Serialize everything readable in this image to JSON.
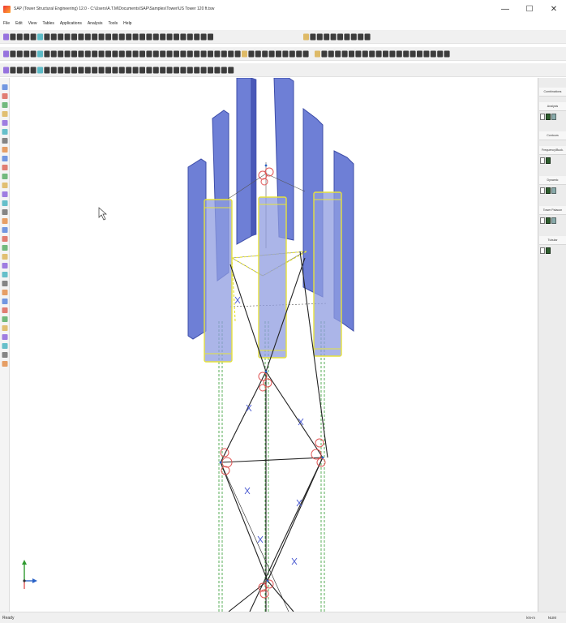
{
  "window": {
    "title": "SAP (Tower Structural Engineering) 12.0 - C:\\Users\\A.T.M\\Documents\\SAP\\Samples\\Tower\\US Tower 120 ft.tsw",
    "minimize": "—",
    "maximize": "☐",
    "close": "✕"
  },
  "menu": [
    "File",
    "Edit",
    "View",
    "Tables",
    "Applications",
    "Analysis",
    "Tools",
    "Help"
  ],
  "right_panel": {
    "combinations": "Combinations",
    "groups": [
      "Analysis",
      "Contours",
      "Frequency/Buck.",
      "Dynamic",
      "Tower Palacon",
      "Tubular"
    ]
  },
  "status": {
    "left": "Ready",
    "unit": "kN-m",
    "system": "NUM"
  },
  "colors": {
    "antenna_fill": "#6e7fd6",
    "antenna_edge": "#3c4ca8",
    "highlight": "#e6e23c",
    "member": "#222222",
    "support_circle": "#e05757",
    "guide_line": "#2f9a2f"
  },
  "icons": [
    "app-icon",
    "pointer-icon",
    "axis-triad-icon"
  ]
}
